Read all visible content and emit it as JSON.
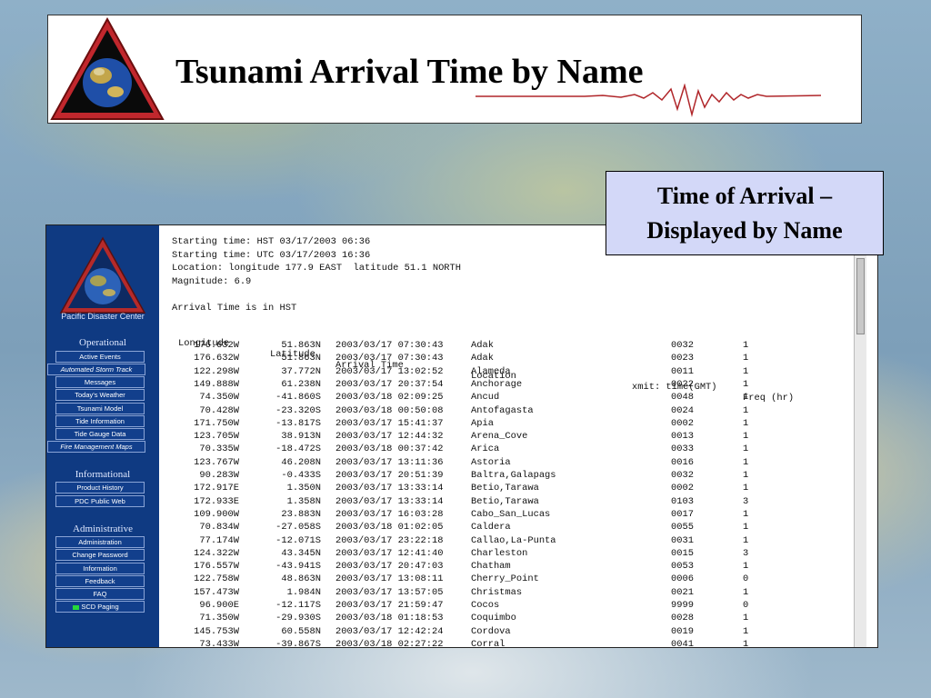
{
  "slide": {
    "title": "Tsunami Arrival Time by Name",
    "callout_line1": "Time of Arrival –",
    "callout_line2": "Displayed by Name"
  },
  "sidebar": {
    "org_name": "Pacific Disaster Center",
    "sections": [
      {
        "heading": "Operational",
        "items": [
          "Active Events",
          "Automated Storm Track",
          "Messages",
          "Today's Weather",
          "Tsunami Model",
          "Tide Information",
          "Tide Gauge Data",
          "Fire Management Maps"
        ]
      },
      {
        "heading": "Informational",
        "items": [
          "Product History",
          "PDC Public Web"
        ]
      },
      {
        "heading": "Administrative",
        "items": [
          "Administration",
          "Change Password",
          "Information",
          "Feedback",
          "FAQ",
          "SCD Paging"
        ]
      }
    ]
  },
  "report": {
    "starting_hst": "Starting time: HST 03/17/2003 06:36",
    "starting_utc": "Starting time: UTC 03/17/2003 16:36",
    "location": "Location: longitude 177.9 EAST  latitude 51.1 NORTH",
    "magnitude": "Magnitude: 6.9",
    "arrival_note": "Arrival Time is in HST",
    "headers": [
      "Longitude",
      "Latitude",
      "Arrival Time",
      "Location",
      "xmit: time(GMT)",
      "Freq (hr)"
    ],
    "rows": [
      [
        "176.632W",
        "51.863N",
        "2003/03/17 07:30:43",
        "Adak",
        "0032",
        "1"
      ],
      [
        "176.632W",
        "51.863N",
        "2003/03/17 07:30:43",
        "Adak",
        "0023",
        "1"
      ],
      [
        "122.298W",
        "37.772N",
        "2003/03/17 13:02:52",
        "Alameda",
        "0011",
        "1"
      ],
      [
        "149.888W",
        "61.238N",
        "2003/03/17 20:37:54",
        "Anchorage",
        "0022",
        "1"
      ],
      [
        "74.350W",
        "-41.860S",
        "2003/03/18 02:09:25",
        "Ancud",
        "0048",
        "1"
      ],
      [
        "70.428W",
        "-23.320S",
        "2003/03/18 00:50:08",
        "Antofagasta",
        "0024",
        "1"
      ],
      [
        "171.750W",
        "-13.817S",
        "2003/03/17 15:41:37",
        "Apia",
        "0002",
        "1"
      ],
      [
        "123.705W",
        "38.913N",
        "2003/03/17 12:44:32",
        "Arena_Cove",
        "0013",
        "1"
      ],
      [
        "70.335W",
        "-18.472S",
        "2003/03/18 00:37:42",
        "Arica",
        "0033",
        "1"
      ],
      [
        "123.767W",
        "46.208N",
        "2003/03/17 13:11:36",
        "Astoria",
        "0016",
        "1"
      ],
      [
        "90.283W",
        "-0.433S",
        "2003/03/17 20:51:39",
        "Baltra,Galapags",
        "0032",
        "1"
      ],
      [
        "172.917E",
        "1.350N",
        "2003/03/17 13:33:14",
        "Betio,Tarawa",
        "0002",
        "1"
      ],
      [
        "172.933E",
        "1.358N",
        "2003/03/17 13:33:14",
        "Betio,Tarawa",
        "0103",
        "3"
      ],
      [
        "109.900W",
        "23.883N",
        "2003/03/17 16:03:28",
        "Cabo_San_Lucas",
        "0017",
        "1"
      ],
      [
        "70.834W",
        "-27.058S",
        "2003/03/18 01:02:05",
        "Caldera",
        "0055",
        "1"
      ],
      [
        "77.174W",
        "-12.071S",
        "2003/03/17 23:22:18",
        "Callao,La-Punta",
        "0031",
        "1"
      ],
      [
        "124.322W",
        "43.345N",
        "2003/03/17 12:41:40",
        "Charleston",
        "0015",
        "3"
      ],
      [
        "176.557W",
        "-43.941S",
        "2003/03/17 20:47:03",
        "Chatham",
        "0053",
        "1"
      ],
      [
        "122.758W",
        "48.863N",
        "2003/03/17 13:08:11",
        "Cherry_Point",
        "0006",
        "0"
      ],
      [
        "157.473W",
        "1.984N",
        "2003/03/17 13:57:05",
        "Christmas",
        "0021",
        "1"
      ],
      [
        "96.900E",
        "-12.117S",
        "2003/03/17 21:59:47",
        "Cocos",
        "9999",
        "0"
      ],
      [
        "71.350W",
        "-29.930S",
        "2003/03/18 01:18:53",
        "Coquimbo",
        "0028",
        "1"
      ],
      [
        "145.753W",
        "60.558N",
        "2003/03/17 12:42:24",
        "Cordova",
        "0019",
        "1"
      ],
      [
        "73.433W",
        "-39.867S",
        "2003/03/18 02:27:22",
        "Corral",
        "0041",
        "1"
      ]
    ]
  },
  "colors": {
    "sidebar_bg": "#0f3a82",
    "callout_bg": "#d3d8f8",
    "paging_indicator": "#26d83a",
    "seismo_line": "#b0262a"
  }
}
